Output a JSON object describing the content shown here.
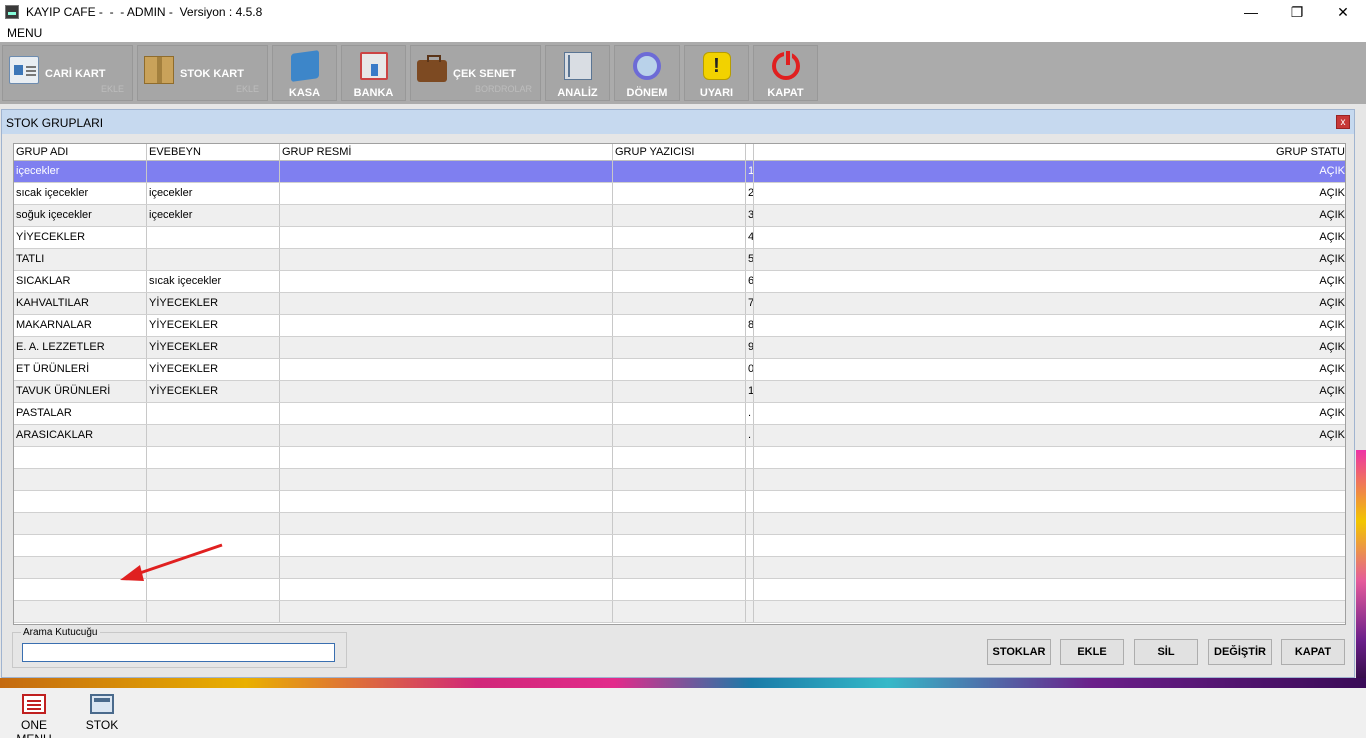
{
  "window": {
    "title": "KAYIP CAFE -  -  - ADMIN -  Versiyon : 4.5.8"
  },
  "menu": {
    "label": "MENU"
  },
  "toolbar": [
    {
      "label": "CARİ KART",
      "sub": "EKLE",
      "icon": "contact-card-icon"
    },
    {
      "label": "STOK KART",
      "sub": "EKLE",
      "icon": "box-icon"
    },
    {
      "label": "KASA",
      "icon": "cash-register-icon"
    },
    {
      "label": "BANKA",
      "icon": "bank-icon"
    },
    {
      "label": "ÇEK SENET",
      "sub": "BORDROLAR",
      "icon": "briefcase-icon"
    },
    {
      "label": "ANALİZ",
      "icon": "book-icon"
    },
    {
      "label": "DÖNEM",
      "icon": "period-ring-icon"
    },
    {
      "label": "UYARI",
      "icon": "warning-icon",
      "glyph": "!"
    },
    {
      "label": "KAPAT",
      "icon": "power-icon"
    }
  ],
  "dialog": {
    "title": "STOK GRUPLARI",
    "close": "x",
    "columns": [
      "GRUP ADI",
      "EVEBEYN",
      "GRUP RESMİ",
      "GRUP YAZICISI",
      "",
      "GRUP STATU"
    ],
    "rows": [
      {
        "name": "içecekler",
        "parent": "",
        "image": "",
        "printer": "",
        "mark": "1",
        "status": "AÇIK"
      },
      {
        "name": "sıcak içecekler",
        "parent": "içecekler",
        "image": "",
        "printer": "",
        "mark": "2",
        "status": "AÇIK"
      },
      {
        "name": "soğuk içecekler",
        "parent": "içecekler",
        "image": "",
        "printer": "",
        "mark": "3",
        "status": "AÇIK"
      },
      {
        "name": "YİYECEKLER",
        "parent": "",
        "image": "",
        "printer": "",
        "mark": "4",
        "status": "AÇIK"
      },
      {
        "name": "TATLI",
        "parent": "",
        "image": "",
        "printer": "",
        "mark": "5",
        "status": "AÇIK"
      },
      {
        "name": "SICAKLAR",
        "parent": "sıcak içecekler",
        "image": "",
        "printer": "",
        "mark": "6",
        "status": "AÇIK"
      },
      {
        "name": "KAHVALTILAR",
        "parent": "YİYECEKLER",
        "image": "",
        "printer": "",
        "mark": "7",
        "status": "AÇIK"
      },
      {
        "name": "MAKARNALAR",
        "parent": "YİYECEKLER",
        "image": "",
        "printer": "",
        "mark": "8",
        "status": "AÇIK"
      },
      {
        "name": "E. A. LEZZETLER",
        "parent": "YİYECEKLER",
        "image": "",
        "printer": "",
        "mark": "9",
        "status": "AÇIK"
      },
      {
        "name": "ET ÜRÜNLERİ",
        "parent": "YİYECEKLER",
        "image": "",
        "printer": "",
        "mark": "0",
        "status": "AÇIK"
      },
      {
        "name": "TAVUK ÜRÜNLERİ",
        "parent": "YİYECEKLER",
        "image": "",
        "printer": "",
        "mark": "1",
        "status": "AÇIK"
      },
      {
        "name": "PASTALAR",
        "parent": "",
        "image": "",
        "printer": "",
        "mark": ".",
        "status": "AÇIK"
      },
      {
        "name": "ARASICAKLAR",
        "parent": "",
        "image": "",
        "printer": "",
        "mark": ".",
        "status": "AÇIK"
      }
    ],
    "search": {
      "legend": "Arama Kutucuğu",
      "value": ""
    },
    "buttons": {
      "stoklar": "STOKLAR",
      "ekle": "EKLE",
      "sil": "SİL",
      "degistir": "DEĞİŞTİR",
      "kapat": "KAPAT"
    }
  },
  "taskbar": [
    {
      "label": "ONE MENU",
      "icon": "menu-window-icon"
    },
    {
      "label": "STOK ...",
      "icon": "stock-window-icon"
    }
  ],
  "colors": {
    "selected_row": "#7f7ff0",
    "toolbar": "#ababab",
    "dialog_title": "#c6d9ef",
    "arrow": "#e02020"
  }
}
